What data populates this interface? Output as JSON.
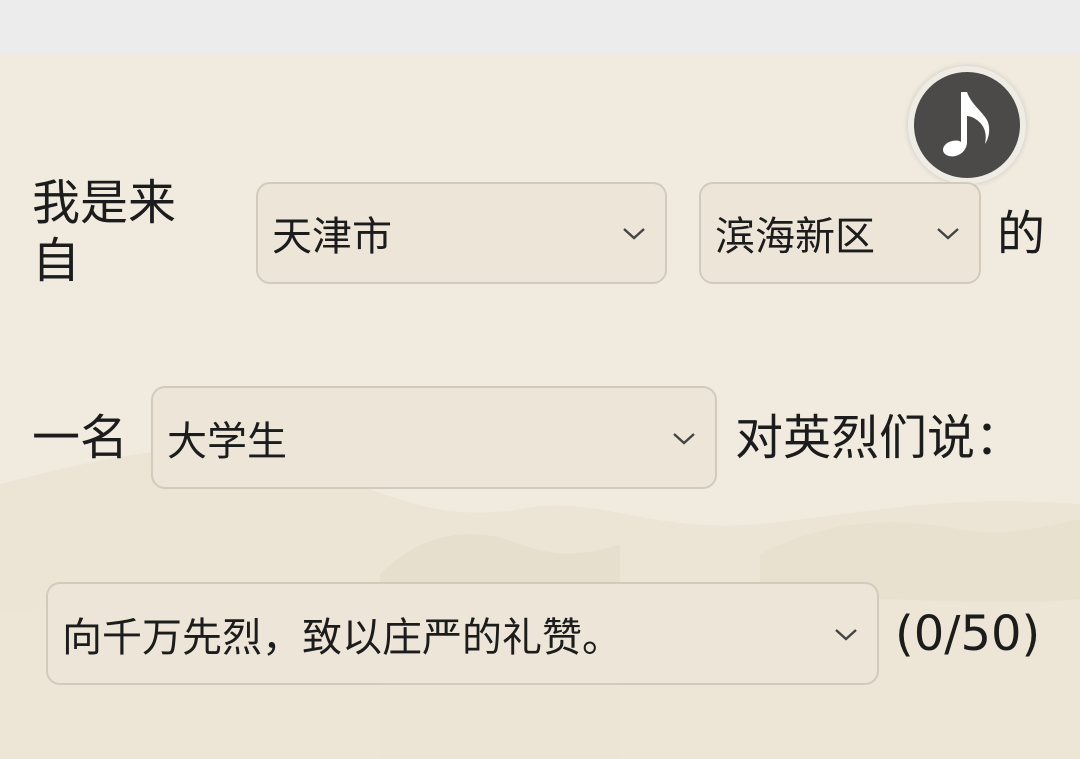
{
  "form": {
    "from_prefix": "我是来自",
    "city": "天津市",
    "district": "滨海新区",
    "de": "的",
    "yi_ming": "一名",
    "identity": "大学生",
    "to_martyrs": "对英烈们说：",
    "message": "向千万先烈，致以庄严的礼赞。",
    "counter": "(0/50)"
  },
  "icons": {
    "music": "music-note-icon",
    "chevron": "chevron-down-icon"
  },
  "colors": {
    "paper": "#f1ebdf",
    "select_bg": "#ede6d8",
    "select_border": "#d2cbbd",
    "music_button": "#4c4a48"
  }
}
